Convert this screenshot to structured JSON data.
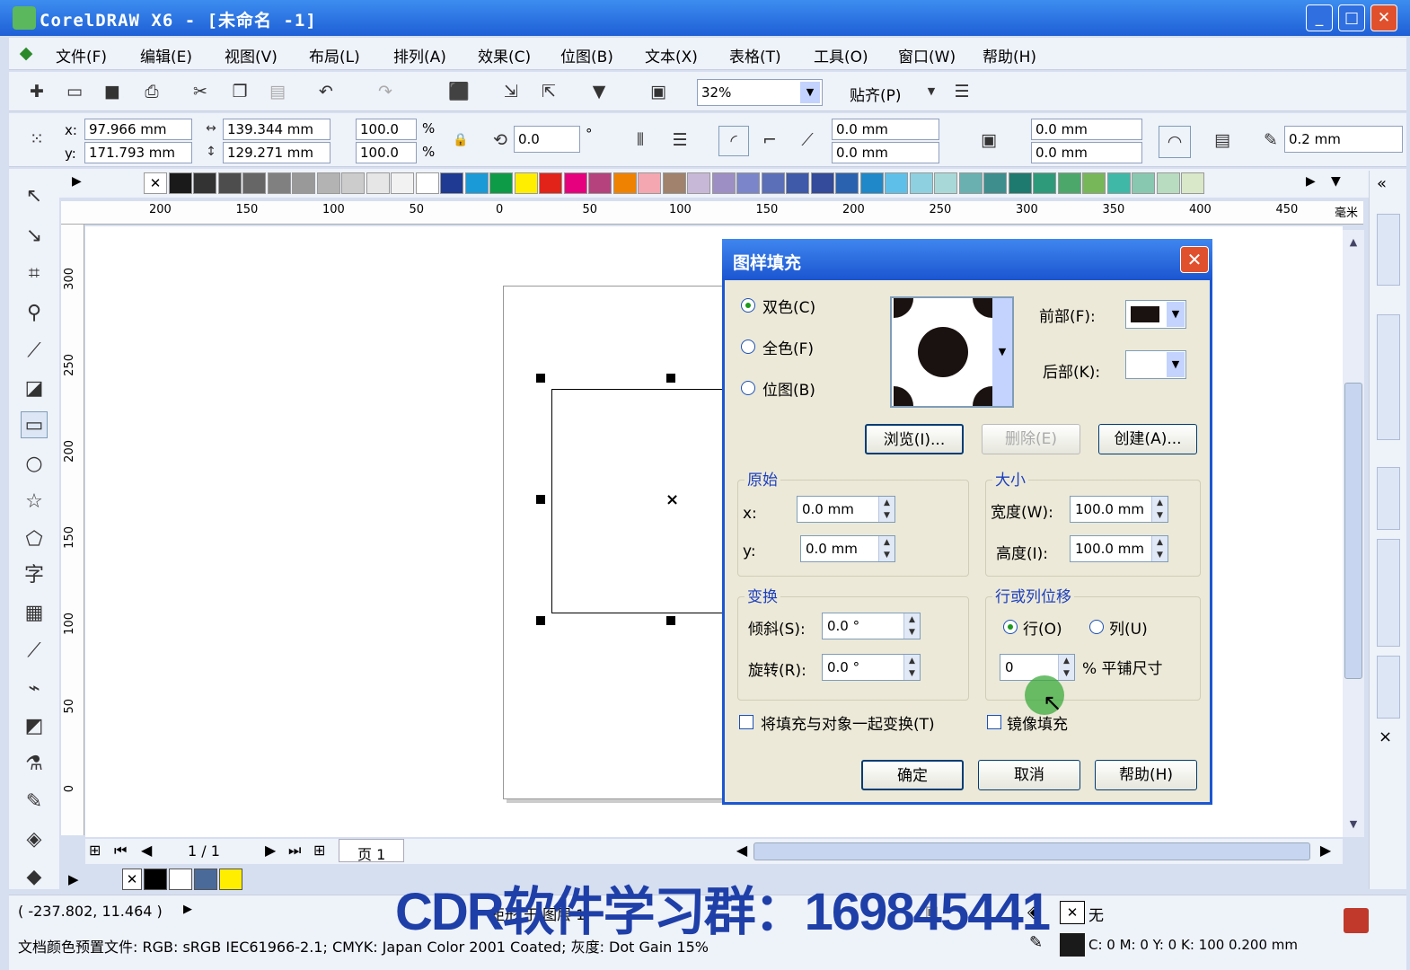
{
  "window": {
    "title": "CorelDRAW X6 - [未命名 -1]",
    "min": "_",
    "max": "□",
    "close": "✕"
  },
  "menu": [
    "文件(F)",
    "编辑(E)",
    "视图(V)",
    "布局(L)",
    "排列(A)",
    "效果(C)",
    "位图(B)",
    "文本(X)",
    "表格(T)",
    "工具(O)",
    "窗口(W)",
    "帮助(H)"
  ],
  "toolbar": {
    "zoom": "32%",
    "snap": "贴齐(P)"
  },
  "props": {
    "x_label": "x:",
    "x": "97.966 mm",
    "y_label": "y:",
    "y": "171.793 mm",
    "w": "139.344 mm",
    "h": "129.271 mm",
    "sx": "100.0",
    "sy": "100.0",
    "pct": "%",
    "rot": "0.0",
    "deg": "°",
    "c1": "0.0 mm",
    "c2": "0.0 mm",
    "c3": "0.0 mm",
    "c4": "0.0 mm",
    "outline": "0.2 mm"
  },
  "palette_colors": [
    "#ffffff",
    "#1a1a1a",
    "#333333",
    "#4d4d4d",
    "#666666",
    "#808080",
    "#999999",
    "#b3b3b3",
    "#cccccc",
    "#e6e6e6",
    "#f2f2f2",
    "#ffffff",
    "#1f3a93",
    "#1a9ad6",
    "#0e9b48",
    "#ffee00",
    "#e2231a",
    "#e6007e",
    "#b5427d",
    "#ef8200",
    "#f4a7b0",
    "#a0826d",
    "#c8b8d8",
    "#9d8fc4",
    "#7a86c9",
    "#5b6fb8",
    "#3f5aa8",
    "#344a9a",
    "#2a62b0",
    "#1e88c9",
    "#5ec0e8",
    "#8ed0e0",
    "#a9d8d8",
    "#6ab0b0",
    "#3e8e8e",
    "#1e7a6e",
    "#2f9a7a",
    "#4ca86a",
    "#78b65a",
    "#40b8a8",
    "#88c8b0",
    "#b8dcc0",
    "#d8e8c8"
  ],
  "hruler": [
    "200",
    "150",
    "100",
    "50",
    "0",
    "50",
    "100",
    "150",
    "200",
    "250",
    "300",
    "350",
    "400",
    "450",
    "毫米"
  ],
  "vruler": [
    "300",
    "250",
    "200",
    "150",
    "100",
    "50",
    "0"
  ],
  "pagebar": {
    "count": "1 / 1",
    "page": "页 1"
  },
  "docpal": [
    "#000000",
    "#ffffff",
    "#4a6a9a",
    "#ffee00"
  ],
  "status": {
    "coords": "( -237.802, 11.464 )",
    "layer": "矩形 于 图层 1",
    "fill": "无",
    "profile": "文档颜色预置文件: RGB: sRGB IEC61966-2.1; CMYK: Japan Color 2001 Coated; 灰度: Dot Gain 15%",
    "outline": "C: 0 M: 0 Y: 0 K: 100  0.200 mm"
  },
  "watermark": "CDR软件学习群：169845441",
  "dialog": {
    "title": "图样填充",
    "close": "✕",
    "r_twocolor": "双色(C)",
    "r_fullcolor": "全色(F)",
    "r_bitmap": "位图(B)",
    "front_label": "前部(F):",
    "back_label": "后部(K):",
    "browse": "浏览(I)...",
    "delete": "删除(E)",
    "create": "创建(A)...",
    "origin_title": "原始",
    "ox_label": "x:",
    "ox": "0.0 mm",
    "oy_label": "y:",
    "oy": "0.0 mm",
    "size_title": "大小",
    "w_label": "宽度(W):",
    "w": "100.0 mm",
    "h_label": "高度(I):",
    "h": "100.0 mm",
    "transform_title": "变换",
    "skew_label": "倾斜(S):",
    "skew": "0.0 °",
    "rot_label": "旋转(R):",
    "rot": "0.0 °",
    "offset_title": "行或列位移",
    "row": "行(O)",
    "col": "列(U)",
    "offset": "0",
    "tile_label": "% 平铺尺寸",
    "transform_with": "将填充与对象一起变换(T)",
    "mirror": "镜像填充",
    "ok": "确定",
    "cancel": "取消",
    "help": "帮助(H)"
  }
}
